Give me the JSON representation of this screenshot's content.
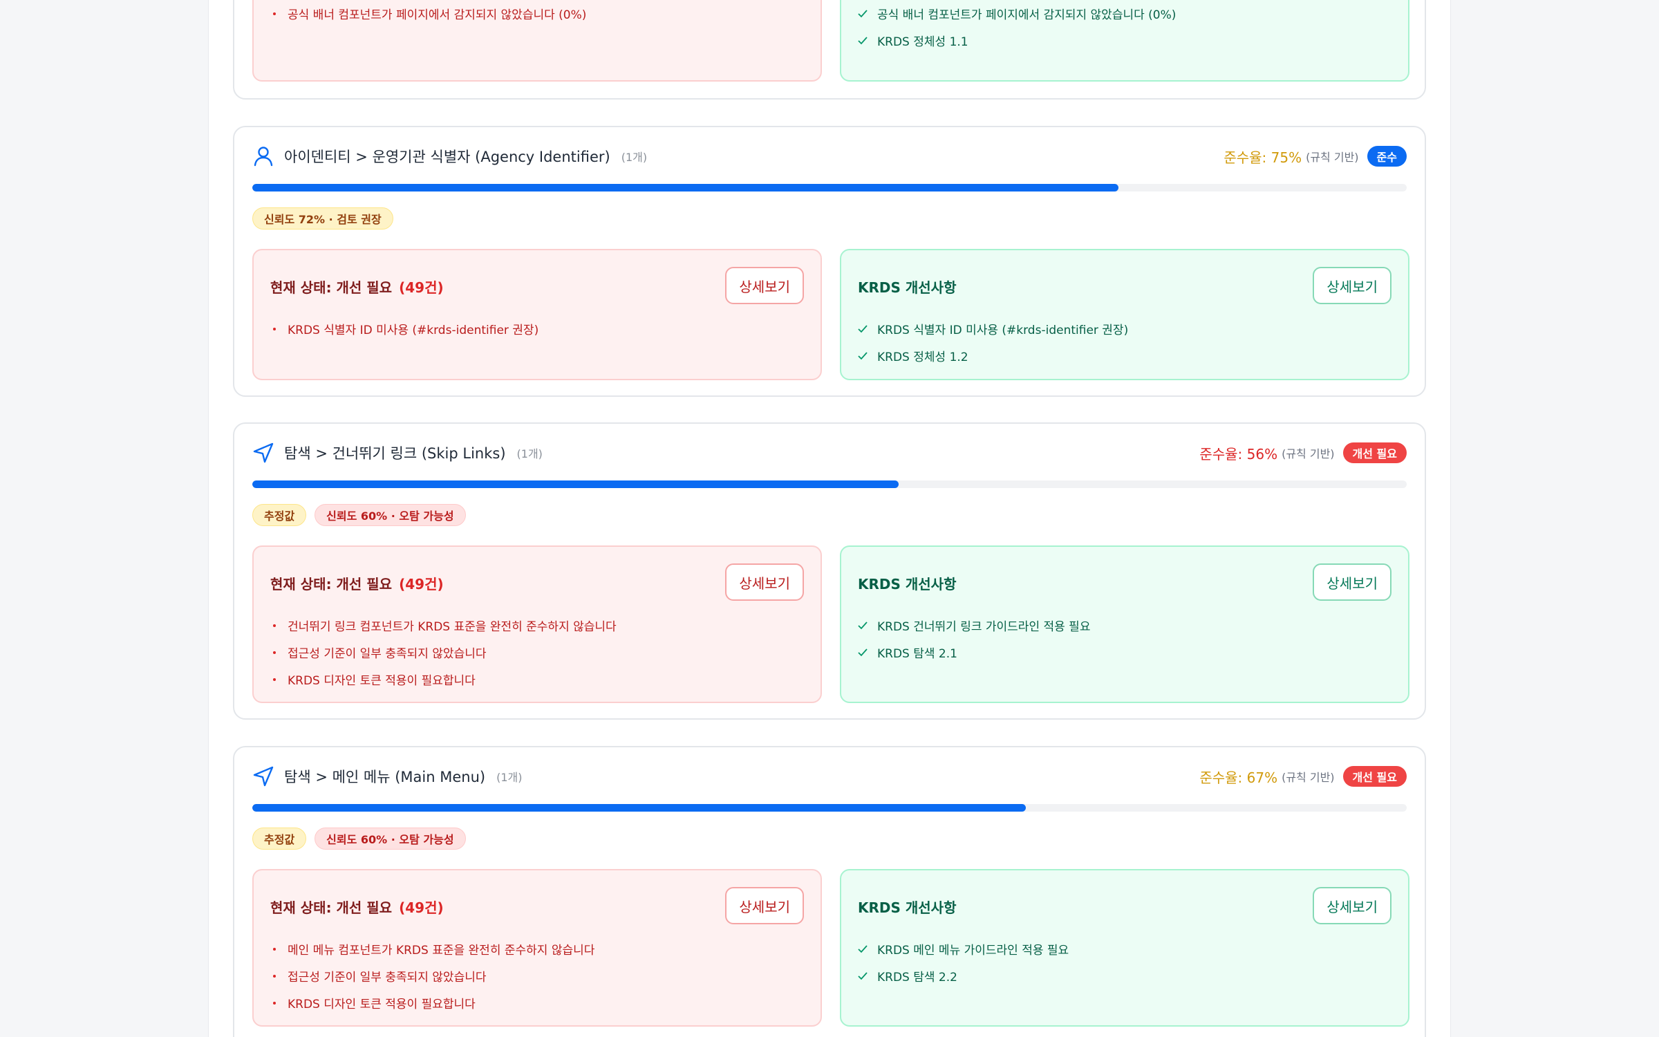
{
  "detail_label": "상세보기",
  "rate_basis": "(규칙 기반)",
  "colors": {
    "primary": "#0b6bf2",
    "rate_warn": "#d19a0b",
    "rate_bad": "#dc2626",
    "pill_ok": "#0b6bf2",
    "pill_bad": "#ef4444"
  },
  "top_card": {
    "left_items": [
      "공식 배너 컴포넌트가 페이지에서 감지되지 않았습니다 (0%)"
    ],
    "right_items": [
      "공식 배너 컴포넌트가 페이지에서 감지되지 않았습니다 (0%)",
      "KRDS 정체성 1.1"
    ]
  },
  "cards": [
    {
      "icon": "user-icon",
      "title": "아이덴티티 > 운영기관 식별자 (Agency Identifier)",
      "count": "(1개)",
      "rate": "준수율: 75%",
      "rate_pct": 75,
      "status": "준수",
      "tags": [
        {
          "text": "신뢰도 72% · 검토 권장",
          "style": "yellow"
        }
      ],
      "left_title": "현재 상태: 개선 필요",
      "left_count": "(49건)",
      "left_items": [
        "KRDS 식별자 ID 미사용 (#krds-identifier 권장)"
      ],
      "right_title": "KRDS 개선사항",
      "right_items": [
        "KRDS 식별자 ID 미사용 (#krds-identifier 권장)",
        "KRDS 정체성 1.2"
      ]
    },
    {
      "icon": "navigation-icon",
      "title": "탐색 > 건너뛰기 링크 (Skip Links)",
      "count": "(1개)",
      "rate": "준수율: 56%",
      "rate_pct": 56,
      "status": "개선 필요",
      "tags": [
        {
          "text": "추정값",
          "style": "yellow"
        },
        {
          "text": "신뢰도 60% · 오탐 가능성",
          "style": "red"
        }
      ],
      "left_title": "현재 상태: 개선 필요",
      "left_count": "(49건)",
      "left_items": [
        "건너뛰기 링크 컴포넌트가 KRDS 표준을 완전히 준수하지 않습니다",
        "접근성 기준이 일부 충족되지 않았습니다",
        "KRDS 디자인 토큰 적용이 필요합니다"
      ],
      "right_title": "KRDS 개선사항",
      "right_items": [
        "KRDS 건너뛰기 링크 가이드라인 적용 필요",
        "KRDS 탐색 2.1"
      ]
    },
    {
      "icon": "navigation-icon",
      "title": "탐색 > 메인 메뉴 (Main Menu)",
      "count": "(1개)",
      "rate": "준수율: 67%",
      "rate_pct": 67,
      "status": "개선 필요",
      "tags": [
        {
          "text": "추정값",
          "style": "yellow"
        },
        {
          "text": "신뢰도 60% · 오탐 가능성",
          "style": "red"
        }
      ],
      "left_title": "현재 상태: 개선 필요",
      "left_count": "(49건)",
      "left_items": [
        "메인 메뉴 컴포넌트가 KRDS 표준을 완전히 준수하지 않습니다",
        "접근성 기준이 일부 충족되지 않았습니다",
        "KRDS 디자인 토큰 적용이 필요합니다"
      ],
      "right_title": "KRDS 개선사항",
      "right_items": [
        "KRDS 메인 메뉴 가이드라인 적용 필요",
        "KRDS 탐색 2.2"
      ]
    }
  ]
}
